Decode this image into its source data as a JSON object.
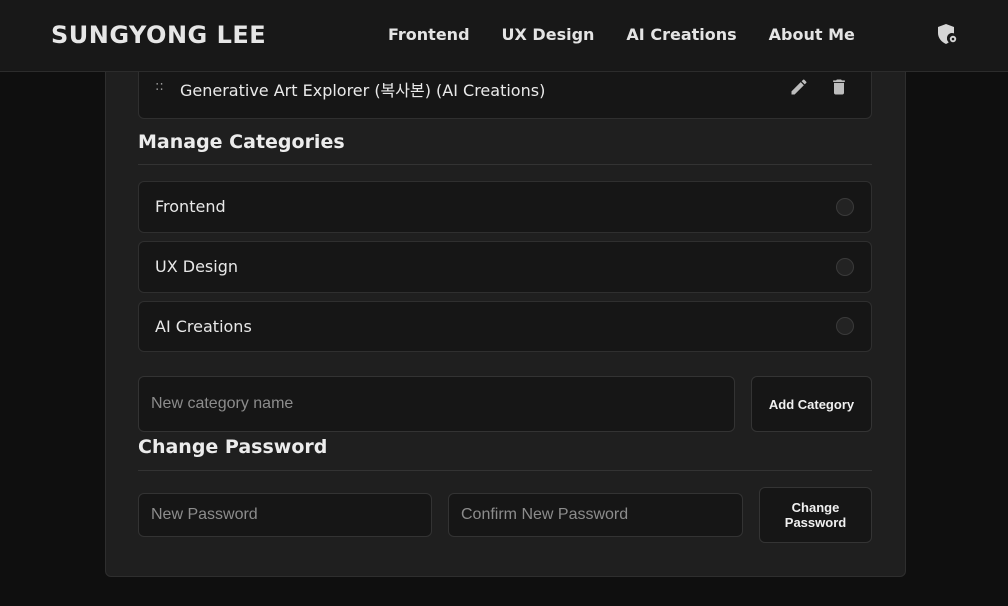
{
  "header": {
    "brand": "SUNGYONG LEE",
    "nav": [
      "Frontend",
      "UX Design",
      "AI Creations",
      "About Me"
    ],
    "admin_icon": "shield-lock-icon"
  },
  "project": {
    "drag_handle": "::",
    "title": "Generative Art Explorer (복사본) (AI Creations)",
    "edit_icon": "pencil-icon",
    "delete_icon": "trash-icon"
  },
  "categories": {
    "title": "Manage Categories",
    "items": [
      "Frontend",
      "UX Design",
      "AI Creations"
    ],
    "new_placeholder": "New category name",
    "add_label": "Add Category"
  },
  "password": {
    "title": "Change Password",
    "new_placeholder": "New Password",
    "confirm_placeholder": "Confirm New Password",
    "change_label": "Change Password"
  },
  "colors": {
    "background": "#0f0f0f",
    "panel": "#1f1f1f",
    "card": "#161616",
    "text": "#e8e8e8"
  }
}
